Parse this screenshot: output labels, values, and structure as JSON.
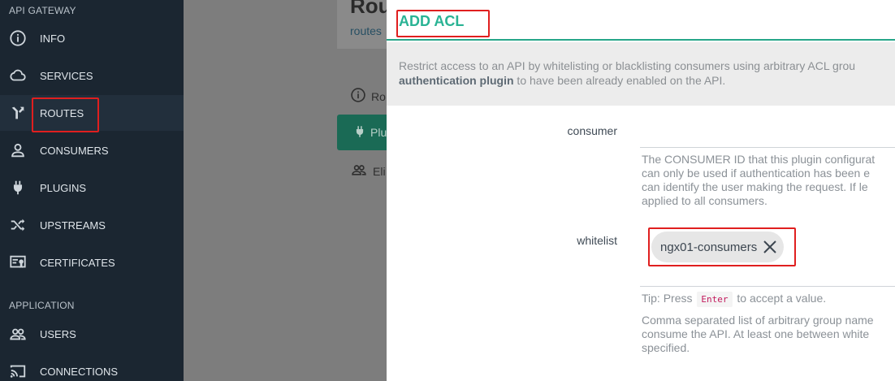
{
  "sidebar": {
    "sections": [
      {
        "label": "API GATEWAY"
      },
      {
        "label": "APPLICATION"
      }
    ],
    "items": [
      {
        "label": "INFO",
        "icon": "info-icon"
      },
      {
        "label": "SERVICES",
        "icon": "cloud-icon"
      },
      {
        "label": "ROUTES",
        "icon": "routes-icon"
      },
      {
        "label": "CONSUMERS",
        "icon": "user-icon"
      },
      {
        "label": "PLUGINS",
        "icon": "plug-icon"
      },
      {
        "label": "UPSTREAMS",
        "icon": "shuffle-icon"
      },
      {
        "label": "CERTIFICATES",
        "icon": "certificate-icon"
      },
      {
        "label": "USERS",
        "icon": "users-icon"
      },
      {
        "label": "CONNECTIONS",
        "icon": "cast-icon"
      }
    ]
  },
  "background": {
    "title": "Rou",
    "breadcrumb": "routes",
    "tabs": [
      {
        "label": "Ro"
      },
      {
        "label": "Plu"
      },
      {
        "label": "Eli"
      }
    ]
  },
  "modal": {
    "title": "ADD ACL",
    "description_line1": "Restrict access to an API by whitelisting or blacklisting consumers using arbitrary ACL grou",
    "description_bold": "authentication plugin",
    "description_line2_rest": " to have been already enabled on the API.",
    "consumer": {
      "label": "consumer",
      "value": "",
      "help": [
        "The CONSUMER ID that this plugin configurat",
        "can only be used if authentication has been e",
        "can identify the user making the request. If le",
        "applied to all consumers."
      ]
    },
    "whitelist": {
      "label": "whitelist",
      "chip": "ngx01-consumers",
      "tip_prefix": "Tip: Press",
      "tip_key": "Enter",
      "tip_suffix": "to accept a value.",
      "help": [
        "Comma separated list of arbitrary group name",
        "consume the API. At least one between white",
        "specified."
      ]
    }
  },
  "colors": {
    "sidebar_bg": "#1b2631",
    "accent": "#29b394",
    "highlight": "#e01f1f"
  }
}
